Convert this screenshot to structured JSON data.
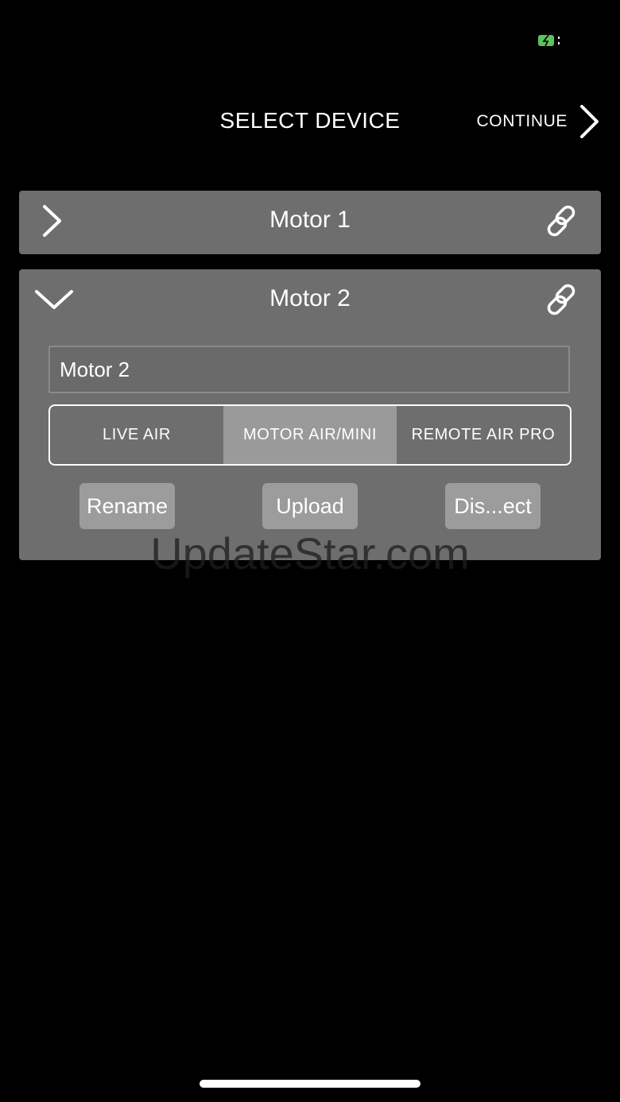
{
  "status_bar": {
    "battery_icon": "battery-charging-icon",
    "battery_color": "#5cc35c"
  },
  "header": {
    "title": "SELECT DEVICE",
    "continue_label": "CONTINUE",
    "continue_icon": "chevron-right-icon"
  },
  "devices": [
    {
      "name": "Motor 1",
      "expanded": false,
      "toggle_icon": "chevron-right-icon",
      "link_icon": "link-icon"
    },
    {
      "name": "Motor 2",
      "expanded": true,
      "toggle_icon": "chevron-down-icon",
      "link_icon": "link-icon",
      "name_input_value": "Motor 2",
      "device_types": [
        "LIVE AIR",
        "MOTOR AIR/MINI",
        "REMOTE AIR PRO"
      ],
      "selected_type": "MOTOR AIR/MINI",
      "actions": {
        "rename": "Rename",
        "upload": "Upload",
        "disconnect": "Dis...ect"
      }
    }
  ],
  "watermark": "UpdateStar.com",
  "colors": {
    "background": "#000000",
    "card": "#6e6e6e",
    "selected_segment": "#9a9a9a",
    "button": "#9c9c9c"
  }
}
